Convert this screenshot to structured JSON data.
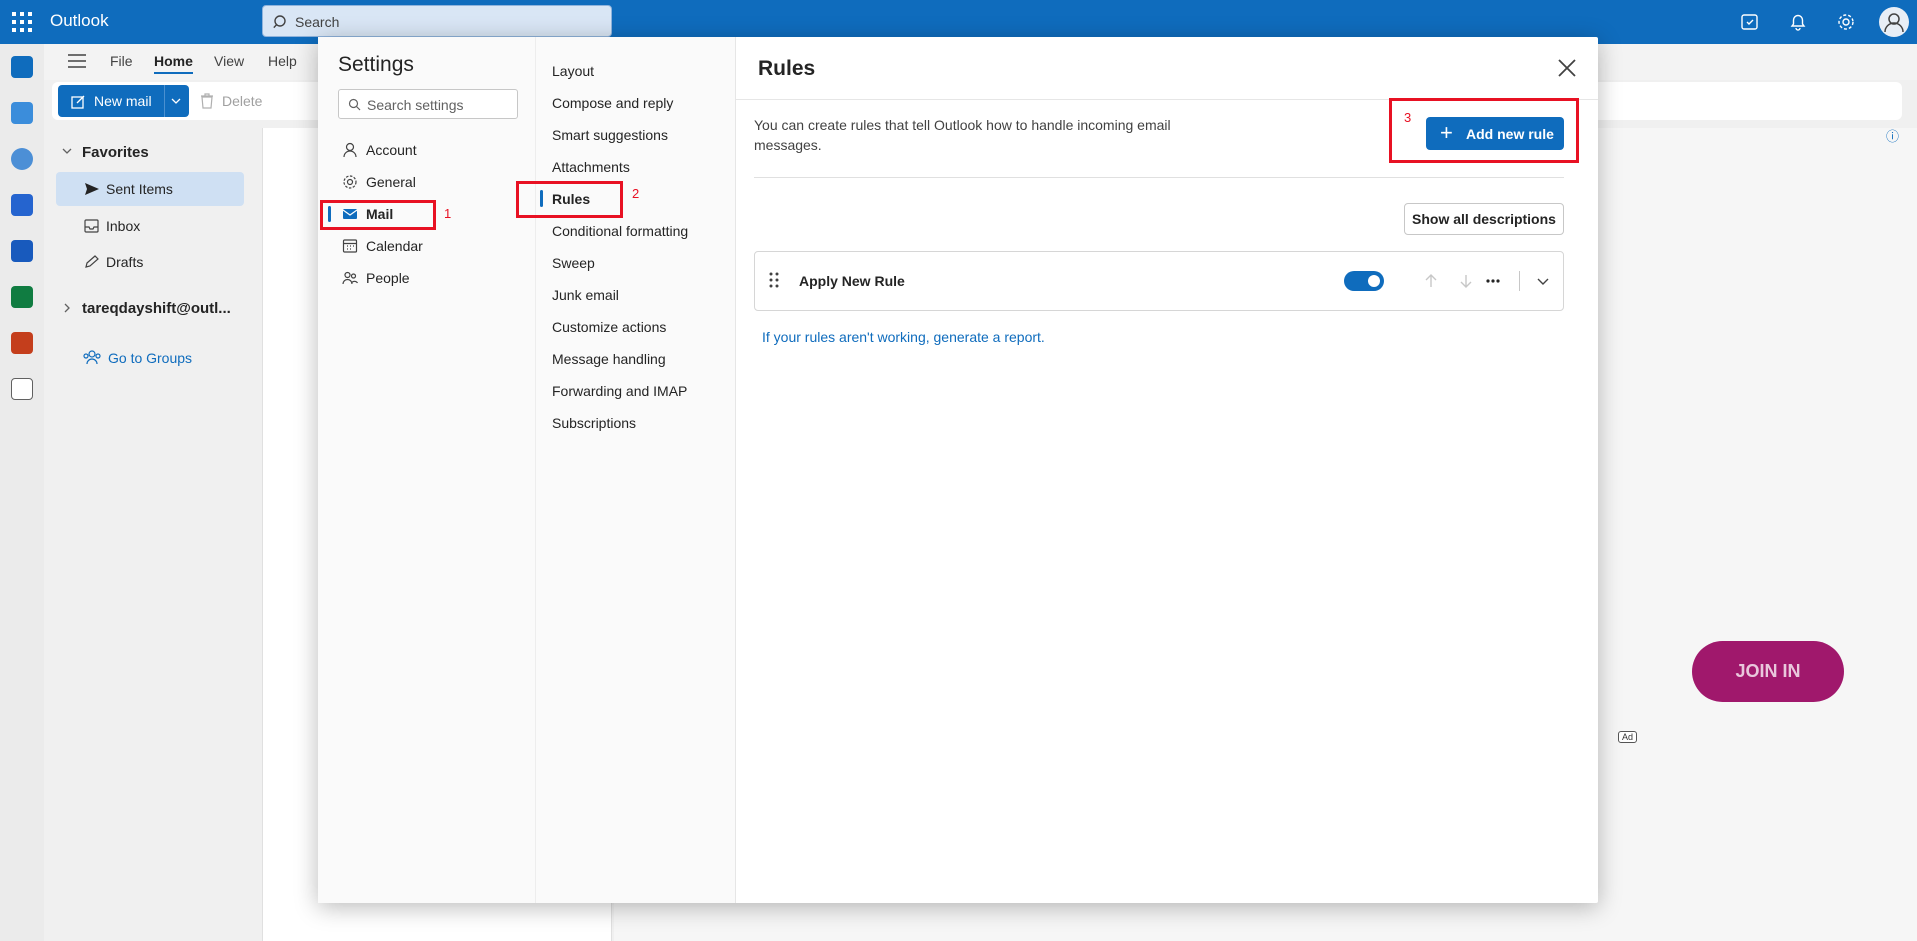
{
  "app": {
    "brand": "Outlook",
    "search_placeholder": "Search"
  },
  "ribbon": {
    "tabs": [
      "File",
      "Home",
      "View",
      "Help"
    ],
    "new_mail": "New mail",
    "delete": "Delete"
  },
  "folders": {
    "favorites": "Favorites",
    "items": [
      "Sent Items",
      "Inbox",
      "Drafts"
    ],
    "account": "tareqdayshift@outl...",
    "go_to_groups": "Go to Groups"
  },
  "reading": {
    "join_in": "JOIN IN",
    "ad": "Ad"
  },
  "settings": {
    "title": "Settings",
    "search_placeholder": "Search settings",
    "categories": [
      "Account",
      "General",
      "Mail",
      "Calendar",
      "People"
    ],
    "mail_sections": [
      "Layout",
      "Compose and reply",
      "Smart suggestions",
      "Attachments",
      "Rules",
      "Conditional formatting",
      "Sweep",
      "Junk email",
      "Customize actions",
      "Message handling",
      "Forwarding and IMAP",
      "Subscriptions"
    ],
    "selected_category": "Mail",
    "selected_section": "Rules"
  },
  "rules": {
    "title": "Rules",
    "description": "You can create rules that tell Outlook how to handle incoming email messages.",
    "add_new_rule": "Add new rule",
    "show_all_descriptions": "Show all descriptions",
    "rule_list": [
      {
        "name": "Apply New Rule",
        "enabled": true
      }
    ],
    "report_link": "If your rules aren't working, generate a report."
  },
  "annotations": [
    "1",
    "2",
    "3"
  ],
  "colors": {
    "accent": "#0f6cbd",
    "annotation": "#e81123",
    "ad_button": "#a0186c"
  }
}
